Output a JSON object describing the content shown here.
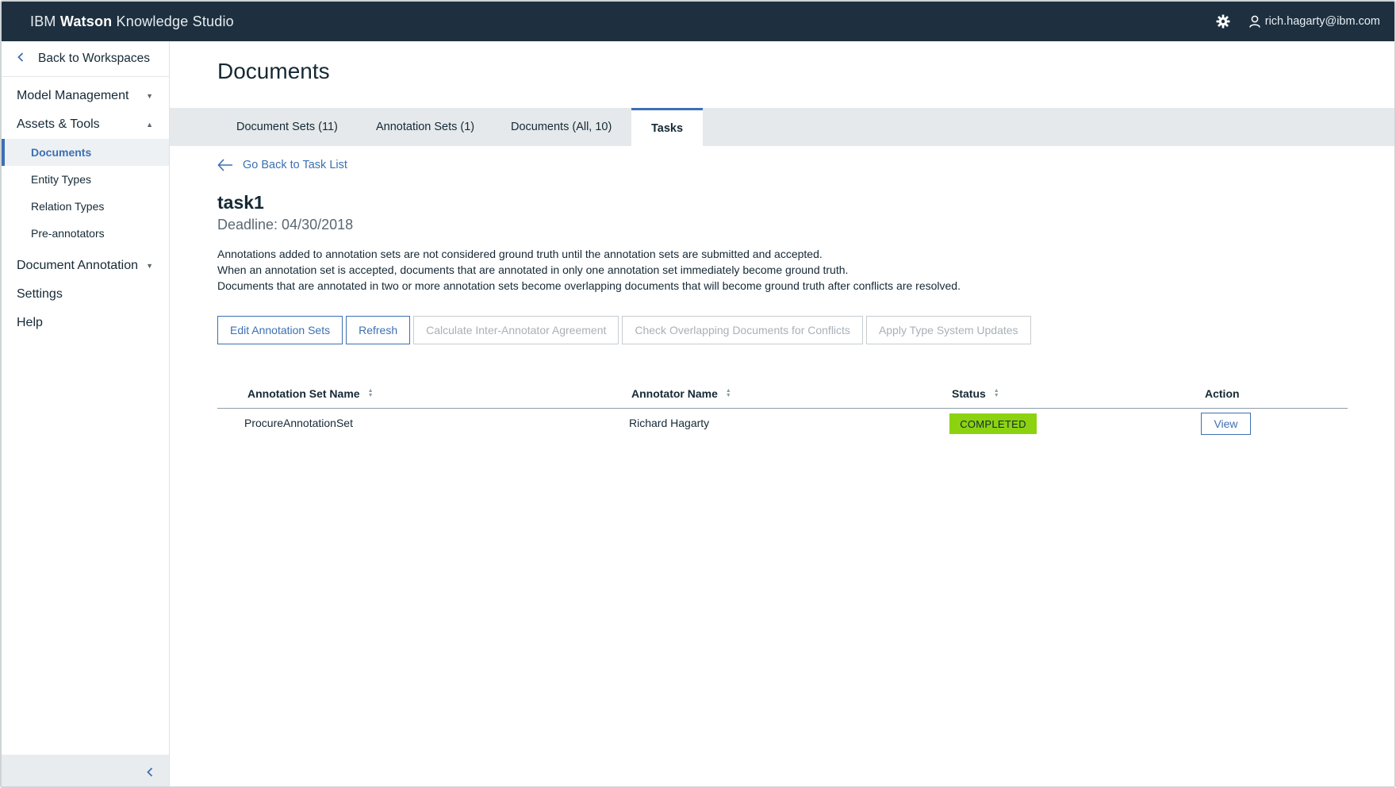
{
  "header": {
    "brand_prefix": "IBM",
    "brand_bold": "Watson",
    "brand_suffix": "Knowledge Studio",
    "user_email": "rich.hagarty@ibm.com"
  },
  "sidebar": {
    "back_label": "Back to Workspaces",
    "groups": [
      {
        "label": "Model Management"
      },
      {
        "label": "Assets & Tools"
      },
      {
        "label": "Document Annotation"
      }
    ],
    "sub_items": [
      {
        "label": "Documents"
      },
      {
        "label": "Entity Types"
      },
      {
        "label": "Relation Types"
      },
      {
        "label": "Pre-annotators"
      }
    ],
    "links": [
      {
        "label": "Settings"
      },
      {
        "label": "Help"
      }
    ]
  },
  "main": {
    "page_title": "Documents",
    "tabs": [
      {
        "label": "Document Sets (11)"
      },
      {
        "label": "Annotation Sets (1)"
      },
      {
        "label": "Documents (All, 10)"
      },
      {
        "label": "Tasks"
      }
    ],
    "back_to_task_list": "Go Back to Task List",
    "task_name": "task1",
    "deadline": "Deadline: 04/30/2018",
    "description": [
      "Annotations added to annotation sets are not considered ground truth until the annotation sets are submitted and accepted.",
      "When an annotation set is accepted, documents that are annotated in only one annotation set immediately become ground truth.",
      "Documents that are annotated in two or more annotation sets become overlapping documents that will become ground truth after conflicts are resolved."
    ],
    "buttons": {
      "edit": "Edit Annotation Sets",
      "refresh": "Refresh",
      "iaa": "Calculate Inter-Annotator Agreement",
      "overlap": "Check Overlapping Documents for Conflicts",
      "type_updates": "Apply Type System Updates"
    },
    "table": {
      "columns": [
        "Annotation Set Name",
        "Annotator Name",
        "Status",
        "Action"
      ],
      "rows": [
        {
          "set_name": "ProcureAnnotationSet",
          "annotator": "Richard Hagarty",
          "status": "COMPLETED",
          "action": "View"
        }
      ]
    }
  },
  "colors": {
    "topbar": "#1e3040",
    "accent": "#3d70b2",
    "status_completed": "#8cd211"
  }
}
